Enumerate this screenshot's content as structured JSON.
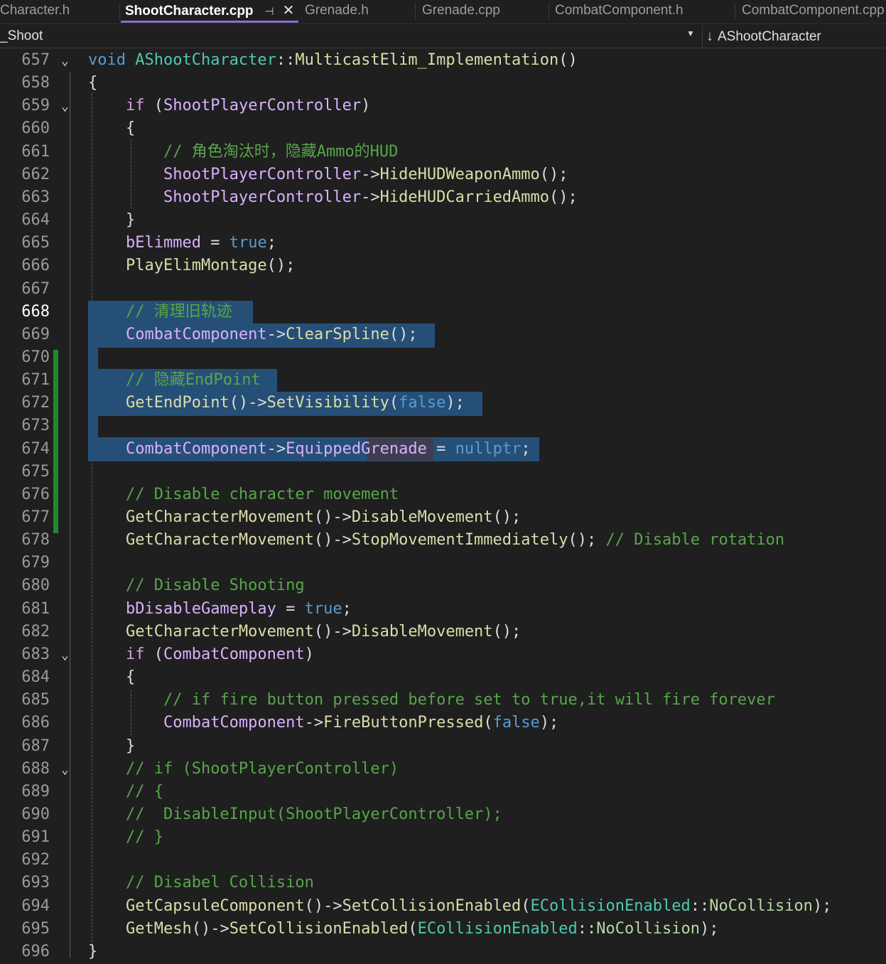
{
  "tabs": [
    {
      "label": "Character.h",
      "active": false
    },
    {
      "label": "ShootCharacter.cpp",
      "active": true
    },
    {
      "label": "Grenade.h",
      "active": false
    },
    {
      "label": "Grenade.cpp",
      "active": false
    },
    {
      "label": "CombatComponent.h",
      "active": false
    },
    {
      "label": "CombatComponent.cpp",
      "active": false
    }
  ],
  "navbar": {
    "project": "_Shoot",
    "scope": "AShootCharacter"
  },
  "colors": {
    "background": "#1f1f1f",
    "selection": "#264f78",
    "change_bar": "#1f8a2c",
    "active_tab_underline": "#8e6bd6"
  },
  "editor": {
    "current_line": "668",
    "lines": [
      {
        "n": "657",
        "fold": true,
        "t": [
          [
            "kw",
            "void "
          ],
          [
            "ty",
            "AShootCharacter"
          ],
          [
            "pu",
            "::"
          ],
          [
            "fn",
            "MulticastElim_Implementation"
          ],
          [
            "pu",
            "()"
          ]
        ]
      },
      {
        "n": "658",
        "t": [
          [
            "pu",
            "{"
          ]
        ]
      },
      {
        "n": "659",
        "fold": true,
        "t": [
          [
            "pu",
            "    "
          ],
          [
            "ctl",
            "if "
          ],
          [
            "pu",
            "("
          ],
          [
            "var",
            "ShootPlayerController"
          ],
          [
            "pu",
            ")"
          ]
        ]
      },
      {
        "n": "660",
        "t": [
          [
            "pu",
            "    {"
          ]
        ]
      },
      {
        "n": "661",
        "t": [
          [
            "pu",
            "        "
          ],
          [
            "cm",
            "// 角色淘汰时，隐藏Ammo的HUD"
          ]
        ]
      },
      {
        "n": "662",
        "t": [
          [
            "pu",
            "        "
          ],
          [
            "var",
            "ShootPlayerController"
          ],
          [
            "pu",
            "->"
          ],
          [
            "fn",
            "HideHUDWeaponAmmo"
          ],
          [
            "pu",
            "();"
          ]
        ]
      },
      {
        "n": "663",
        "t": [
          [
            "pu",
            "        "
          ],
          [
            "var",
            "ShootPlayerController"
          ],
          [
            "pu",
            "->"
          ],
          [
            "fn",
            "HideHUDCarriedAmmo"
          ],
          [
            "pu",
            "();"
          ]
        ]
      },
      {
        "n": "664",
        "t": [
          [
            "pu",
            "    }"
          ]
        ]
      },
      {
        "n": "665",
        "t": [
          [
            "pu",
            "    "
          ],
          [
            "var",
            "bElimmed"
          ],
          [
            "pu",
            " = "
          ],
          [
            "kw",
            "true"
          ],
          [
            "pu",
            ";"
          ]
        ]
      },
      {
        "n": "666",
        "t": [
          [
            "pu",
            "    "
          ],
          [
            "fn",
            "PlayElimMontage"
          ],
          [
            "pu",
            "();"
          ]
        ]
      },
      {
        "n": "667",
        "t": []
      },
      {
        "n": "668",
        "t": [
          [
            "pu",
            "    "
          ],
          [
            "cm",
            "// 清理旧轨迹"
          ]
        ]
      },
      {
        "n": "669",
        "t": [
          [
            "pu",
            "    "
          ],
          [
            "var",
            "CombatComponent"
          ],
          [
            "pu",
            "->"
          ],
          [
            "fn",
            "ClearSpline"
          ],
          [
            "pu",
            "();"
          ]
        ]
      },
      {
        "n": "670",
        "t": []
      },
      {
        "n": "671",
        "t": [
          [
            "pu",
            "    "
          ],
          [
            "cm",
            "// 隐藏EndPoint"
          ]
        ]
      },
      {
        "n": "672",
        "t": [
          [
            "pu",
            "    "
          ],
          [
            "fn",
            "GetEndPoint"
          ],
          [
            "pu",
            "()->"
          ],
          [
            "fn",
            "SetVisibility"
          ],
          [
            "pu",
            "("
          ],
          [
            "kw",
            "false"
          ],
          [
            "pu",
            ");"
          ]
        ]
      },
      {
        "n": "673",
        "t": []
      },
      {
        "n": "674",
        "t": [
          [
            "pu",
            "    "
          ],
          [
            "var",
            "CombatComponent"
          ],
          [
            "pu",
            "->"
          ],
          [
            "mem",
            "EquippedGrenade"
          ],
          [
            "pu",
            " = "
          ],
          [
            "kw",
            "nullptr"
          ],
          [
            "pu",
            ";"
          ]
        ]
      },
      {
        "n": "675",
        "t": []
      },
      {
        "n": "676",
        "t": [
          [
            "pu",
            "    "
          ],
          [
            "cm",
            "// Disable character movement"
          ]
        ]
      },
      {
        "n": "677",
        "t": [
          [
            "pu",
            "    "
          ],
          [
            "fn",
            "GetCharacterMovement"
          ],
          [
            "pu",
            "()->"
          ],
          [
            "fn",
            "DisableMovement"
          ],
          [
            "pu",
            "();"
          ]
        ]
      },
      {
        "n": "678",
        "t": [
          [
            "pu",
            "    "
          ],
          [
            "fn",
            "GetCharacterMovement"
          ],
          [
            "pu",
            "()->"
          ],
          [
            "fn",
            "StopMovementImmediately"
          ],
          [
            "pu",
            "(); "
          ],
          [
            "cm",
            "// Disable rotation"
          ]
        ]
      },
      {
        "n": "679",
        "t": []
      },
      {
        "n": "680",
        "t": [
          [
            "pu",
            "    "
          ],
          [
            "cm",
            "// Disable Shooting"
          ]
        ]
      },
      {
        "n": "681",
        "t": [
          [
            "pu",
            "    "
          ],
          [
            "var",
            "bDisableGameplay"
          ],
          [
            "pu",
            " = "
          ],
          [
            "kw",
            "true"
          ],
          [
            "pu",
            ";"
          ]
        ]
      },
      {
        "n": "682",
        "t": [
          [
            "pu",
            "    "
          ],
          [
            "fn",
            "GetCharacterMovement"
          ],
          [
            "pu",
            "()->"
          ],
          [
            "fn",
            "DisableMovement"
          ],
          [
            "pu",
            "();"
          ]
        ]
      },
      {
        "n": "683",
        "fold": true,
        "t": [
          [
            "pu",
            "    "
          ],
          [
            "ctl",
            "if "
          ],
          [
            "pu",
            "("
          ],
          [
            "var",
            "CombatComponent"
          ],
          [
            "pu",
            ")"
          ]
        ]
      },
      {
        "n": "684",
        "t": [
          [
            "pu",
            "    {"
          ]
        ]
      },
      {
        "n": "685",
        "t": [
          [
            "pu",
            "        "
          ],
          [
            "cm",
            "// if fire button pressed before set to true,it will fire forever"
          ]
        ]
      },
      {
        "n": "686",
        "t": [
          [
            "pu",
            "        "
          ],
          [
            "var",
            "CombatComponent"
          ],
          [
            "pu",
            "->"
          ],
          [
            "fn",
            "FireButtonPressed"
          ],
          [
            "pu",
            "("
          ],
          [
            "kw",
            "false"
          ],
          [
            "pu",
            ");"
          ]
        ]
      },
      {
        "n": "687",
        "t": [
          [
            "pu",
            "    }"
          ]
        ]
      },
      {
        "n": "688",
        "fold": true,
        "t": [
          [
            "pu",
            "    "
          ],
          [
            "cm",
            "// if (ShootPlayerController)"
          ]
        ]
      },
      {
        "n": "689",
        "t": [
          [
            "pu",
            "    "
          ],
          [
            "cm",
            "// {"
          ]
        ]
      },
      {
        "n": "690",
        "t": [
          [
            "pu",
            "    "
          ],
          [
            "cm",
            "//  DisableInput(ShootPlayerController);"
          ]
        ]
      },
      {
        "n": "691",
        "t": [
          [
            "pu",
            "    "
          ],
          [
            "cm",
            "// }"
          ]
        ]
      },
      {
        "n": "692",
        "t": []
      },
      {
        "n": "693",
        "t": [
          [
            "pu",
            "    "
          ],
          [
            "cm",
            "// Disabel Collision"
          ]
        ]
      },
      {
        "n": "694",
        "t": [
          [
            "pu",
            "    "
          ],
          [
            "fn",
            "GetCapsuleComponent"
          ],
          [
            "pu",
            "()->"
          ],
          [
            "fn",
            "SetCollisionEnabled"
          ],
          [
            "pu",
            "("
          ],
          [
            "ty",
            "ECollisionEnabled"
          ],
          [
            "pu",
            "::"
          ],
          [
            "en",
            "NoCollision"
          ],
          [
            "pu",
            ");"
          ]
        ]
      },
      {
        "n": "695",
        "t": [
          [
            "pu",
            "    "
          ],
          [
            "fn",
            "GetMesh"
          ],
          [
            "pu",
            "()->"
          ],
          [
            "fn",
            "SetCollisionEnabled"
          ],
          [
            "pu",
            "("
          ],
          [
            "ty",
            "ECollisionEnabled"
          ],
          [
            "pu",
            "::"
          ],
          [
            "en",
            "NoCollision"
          ],
          [
            "pu",
            ");"
          ]
        ]
      },
      {
        "n": "696",
        "t": [
          [
            "pu",
            "}"
          ]
        ]
      }
    ]
  }
}
